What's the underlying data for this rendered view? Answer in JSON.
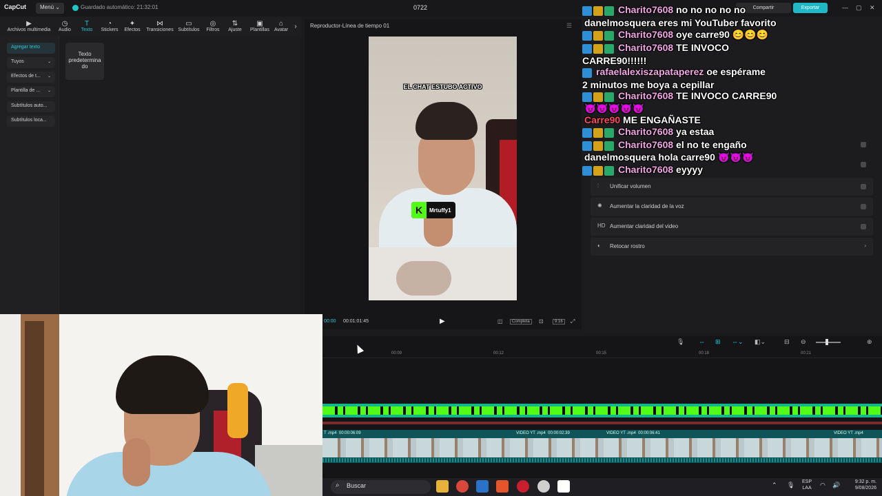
{
  "app": {
    "logo": "CapCut",
    "menu_label": "Menú ⌄",
    "autosave": "Guardado automático: 21:32:01",
    "project_name": "0722",
    "share_label": "Compartir",
    "export_label": "Exportar"
  },
  "toolbar": [
    {
      "label": "Archivos multimedia",
      "icon": "media-icon"
    },
    {
      "label": "Audio",
      "icon": "audio-icon"
    },
    {
      "label": "Texto",
      "icon": "text-icon",
      "active": true
    },
    {
      "label": "Stickers",
      "icon": "sticker-icon"
    },
    {
      "label": "Efectos",
      "icon": "effects-icon"
    },
    {
      "label": "Transiciones",
      "icon": "transitions-icon"
    },
    {
      "label": "Subtítulos",
      "icon": "captions-icon"
    },
    {
      "label": "Filtros",
      "icon": "filters-icon"
    },
    {
      "label": "Ajuste",
      "icon": "adjust-icon"
    },
    {
      "label": "Plantillas",
      "icon": "templates-icon"
    },
    {
      "label": "Avatar",
      "icon": "avatar-icon"
    }
  ],
  "left_panel": {
    "items": [
      "Agregar texto",
      "Tuyos",
      "Efectos de t...",
      "Plantilla de ...",
      "Subtítulos auto...",
      "Subtítulos loca..."
    ],
    "default_text_card": "Texto predetermina do"
  },
  "player": {
    "title": "Reproductor-Línea de tiempo 01",
    "caption": "EL CHAT ESTUBO ACTIVO",
    "kick_user": "Mrtuffy1",
    "time_current": "00:00",
    "time_total": "00:01:01:45",
    "ratio": "Completa",
    "aspect": "9:16"
  },
  "right_panel": {
    "rows": [
      {
        "label": "Unificar volumen",
        "icon": "volume-icon",
        "type": "toggle"
      },
      {
        "label": "Aumentar la claridad de la voz",
        "icon": "voice-icon",
        "type": "toggle"
      },
      {
        "label": "Aumentar claridad del video",
        "icon": "hd-icon",
        "type": "toggle"
      },
      {
        "label": "Retocar rostro",
        "icon": "face-icon",
        "type": "chevron"
      }
    ]
  },
  "chat": [
    {
      "user": "Charito7608",
      "msg": "no no no no no",
      "badges": true,
      "color": "pink"
    },
    {
      "user": "",
      "msg": "danelmosquera eres mi YouTuber favorito",
      "badges": false,
      "color": "none"
    },
    {
      "user": "Charito7608",
      "msg": "oye carre90 😊😊😊",
      "badges": true,
      "color": "pink"
    },
    {
      "user": "Charito7608",
      "msg": "TE INVOCO",
      "badges": true,
      "color": "pink"
    },
    {
      "user": "",
      "msg": "CARRE90!!!!!!",
      "badges": false,
      "color": "none"
    },
    {
      "user": "rafaelalexiszapataperez",
      "msg": "oe espérame",
      "badges": true,
      "color": "pink"
    },
    {
      "user": "",
      "msg": "2 minutos me boya a cepillar",
      "badges": false,
      "color": "none"
    },
    {
      "user": "Charito7608",
      "msg": "TE INVOCO CARRE90",
      "badges": true,
      "color": "pink"
    },
    {
      "user": "",
      "msg": "😈😈😈😈😈",
      "badges": false,
      "color": "none"
    },
    {
      "user": "Carre90",
      "msg": "ME ENGAÑASTE",
      "badges": false,
      "color": "red"
    },
    {
      "user": "Charito7608",
      "msg": "ya estaa",
      "badges": true,
      "color": "pink"
    },
    {
      "user": "Charito7608",
      "msg": "el no te engaño",
      "badges": true,
      "color": "pink"
    },
    {
      "user": "",
      "msg": "danelmosquera hola carre90 😈😈😈",
      "badges": false,
      "color": "none"
    },
    {
      "user": "Charito7608",
      "msg": "eyyyy",
      "badges": true,
      "color": "pink"
    }
  ],
  "timeline": {
    "ticks": [
      "00:09",
      "00:12",
      "00:15",
      "00:18",
      "00:21"
    ],
    "clips": [
      {
        "name": "T .mp4",
        "time": "00:00:06:09"
      },
      {
        "name": "VIDEO YT .mp4",
        "time": "00:00:02:39"
      },
      {
        "name": "VIDEO YT .mp4",
        "time": "00:00:06:41"
      },
      {
        "name": "VIDEO YT .mp4",
        "time": ""
      }
    ]
  },
  "taskbar": {
    "search_placeholder": "Buscar",
    "lang_top": "ESP",
    "lang_bottom": "LAA",
    "time": "9:32 p. m.",
    "date": "9/08/2026"
  },
  "colors": {
    "accent": "#22c8d8",
    "kick_green": "#53fc18",
    "chat_user": "#f2a6e6",
    "chat_red": "#ff4d5e",
    "export": "#1fb8c6"
  }
}
